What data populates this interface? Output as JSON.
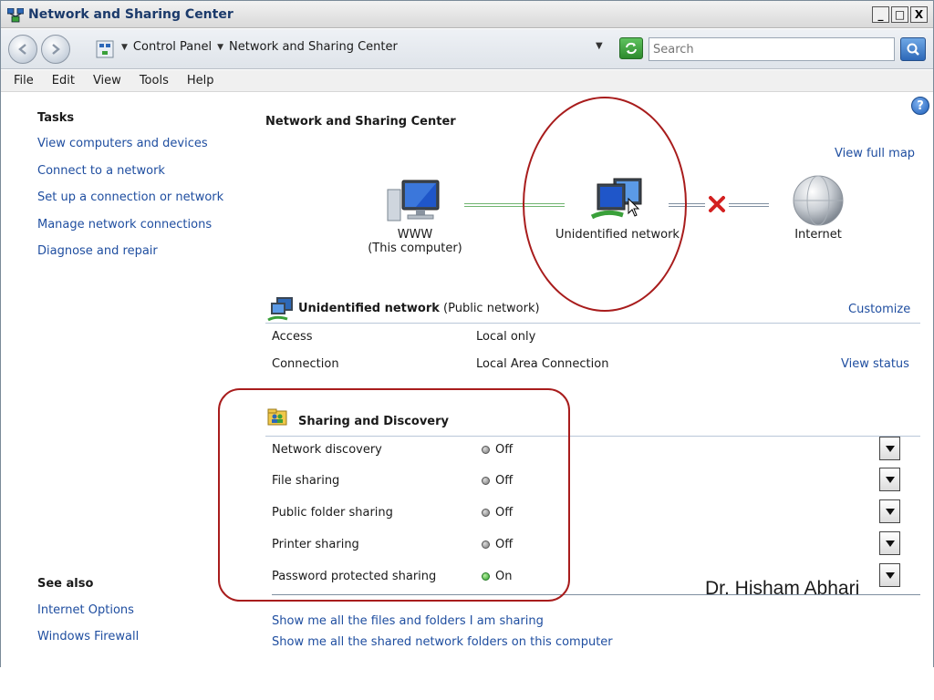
{
  "window": {
    "title": "Network and Sharing Center",
    "controls": {
      "minimize": "_",
      "maximize": "□",
      "close": "X"
    }
  },
  "address": {
    "breadcrumbs": [
      "Control Panel",
      "Network and Sharing Center"
    ],
    "search_placeholder": "Search"
  },
  "menu": [
    "File",
    "Edit",
    "View",
    "Tools",
    "Help"
  ],
  "tasks": {
    "heading": "Tasks",
    "items": [
      "View computers and devices",
      "Connect to a network",
      "Set up a connection or network",
      "Manage network connections",
      "Diagnose and repair"
    ]
  },
  "see_also": {
    "heading": "See also",
    "items": [
      "Internet Options",
      "Windows Firewall"
    ]
  },
  "main": {
    "heading": "Network and Sharing Center",
    "view_full_map": "View full map",
    "map": {
      "computer_name": "WWW",
      "computer_sub": "(This computer)",
      "network_name": "Unidentified network",
      "internet_name": "Internet"
    }
  },
  "network": {
    "name": "Unidentified network",
    "type": "(Public network)",
    "customize": "Customize",
    "rows": [
      {
        "label": "Access",
        "value": "Local only"
      },
      {
        "label": "Connection",
        "value": "Local Area Connection"
      }
    ],
    "view_status": "View status"
  },
  "sharing": {
    "heading": "Sharing and Discovery",
    "rows": [
      {
        "label": "Network discovery",
        "status": "Off"
      },
      {
        "label": "File sharing",
        "status": "Off"
      },
      {
        "label": "Public folder sharing",
        "status": "Off"
      },
      {
        "label": "Printer sharing",
        "status": "Off"
      },
      {
        "label": "Password protected sharing",
        "status": "On"
      }
    ]
  },
  "footer_links": [
    "Show me all the files and folders I am sharing",
    "Show me all the shared network folders on this computer"
  ],
  "watermark": "Dr. Hisham Abhari",
  "colors": {
    "link": "#1f4ea0",
    "annotation": "#a81c1c",
    "status_on": "#2fa12f",
    "status_off": "#777777"
  },
  "icons": {
    "window": "network-center-icon",
    "back": "back-arrow-icon",
    "forward": "forward-arrow-icon",
    "refresh": "refresh-icon",
    "search": "search-icon",
    "help": "help-icon",
    "computer": "computer-icon",
    "network": "network-icon",
    "internet": "globe-icon",
    "broken_link": "red-x-icon",
    "sharing": "sharing-icon"
  }
}
